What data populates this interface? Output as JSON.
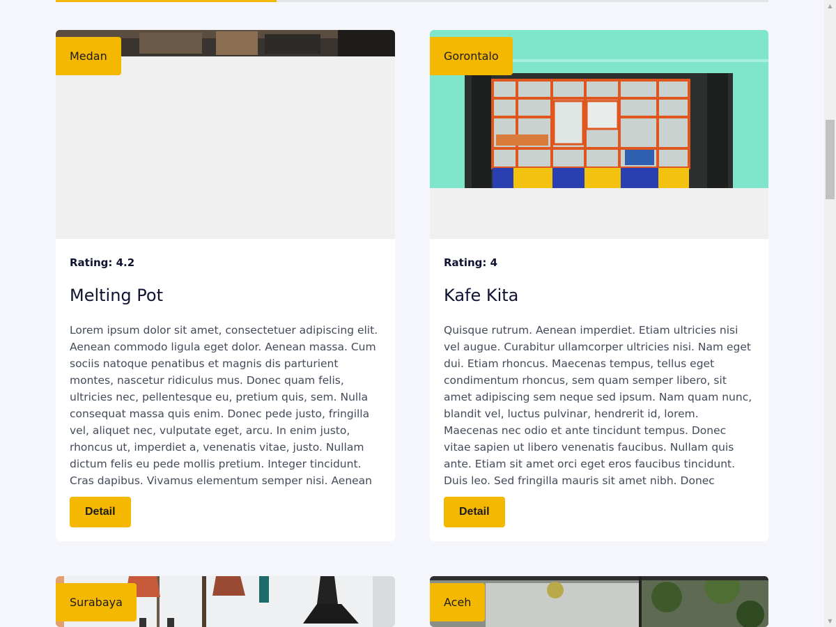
{
  "progress": {
    "fraction": 0.31
  },
  "cards": [
    {
      "city": "Medan",
      "rating": "Rating: 4.2",
      "title": "Melting Pot",
      "description": "Lorem ipsum dolor sit amet, consectetuer adipiscing elit. Aenean commodo ligula eget dolor. Aenean massa. Cum sociis natoque penatibus et magnis dis parturient montes, nascetur ridiculus mus. Donec quam felis, ultricies nec, pellentesque eu, pretium quis, sem. Nulla consequat massa quis enim. Donec pede justo, fringilla vel, aliquet nec, vulputate eget, arcu. In enim justo, rhoncus ut, imperdiet a, venenatis vitae, justo. Nullam dictum felis eu pede mollis pretium. Integer tincidunt. Cras dapibus. Vivamus elementum semper nisi. Aenean vulputate eleifend tellus....",
      "button": "Detail"
    },
    {
      "city": "Gorontalo",
      "rating": "Rating: 4",
      "title": "Kafe Kita",
      "description": "Quisque rutrum. Aenean imperdiet. Etiam ultricies nisi vel augue. Curabitur ullamcorper ultricies nisi. Nam eget dui. Etiam rhoncus. Maecenas tempus, tellus eget condimentum rhoncus, sem quam semper libero, sit amet adipiscing sem neque sed ipsum. Nam quam nunc, blandit vel, luctus pulvinar, hendrerit id, lorem. Maecenas nec odio et ante tincidunt tempus. Donec vitae sapien ut libero venenatis faucibus. Nullam quis ante. Etiam sit amet orci eget eros faucibus tincidunt. Duis leo. Sed fringilla mauris sit amet nibh. Donec sodales sagittis magna. Sed consequat, leo...",
      "button": "Detail"
    },
    {
      "city": "Surabaya"
    },
    {
      "city": "Aceh"
    }
  ],
  "colors": {
    "accent": "#f5b800",
    "background": "#f5f6fb"
  }
}
